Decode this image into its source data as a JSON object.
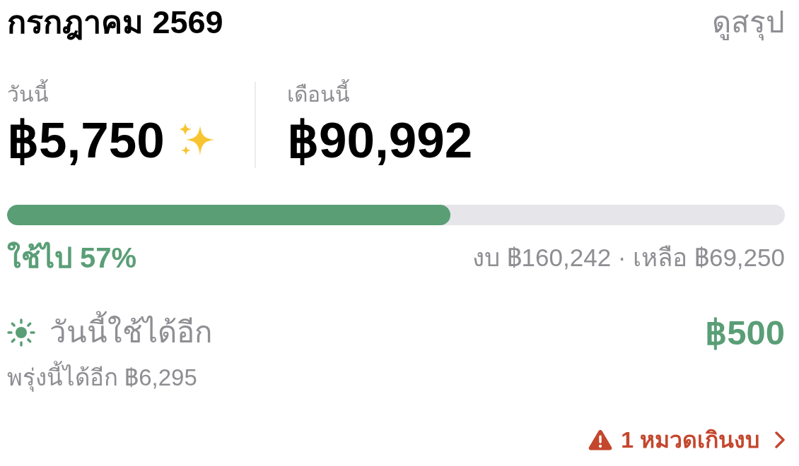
{
  "header": {
    "title": "กรกฎาคม 2569",
    "summary_link": "ดูสรุป"
  },
  "stats": [
    {
      "label": "วันนี้",
      "amount": "฿5,750",
      "sparkle": true
    },
    {
      "label": "เดือนนี้",
      "amount": "฿90,992",
      "sparkle": false
    }
  ],
  "budget": {
    "level": 0.57,
    "used": "ใช้ไป 57%",
    "summary": "งบ ฿160,242 · เหลือ ฿69,250"
  },
  "allowance": {
    "label": "วันนี้ใช้ได้อีก",
    "amount": "฿500",
    "tomorrow": "พรุ่งนี้ได้อีก ฿6,295"
  },
  "alert": {
    "text": "1 หมวดเกินงบ"
  }
}
